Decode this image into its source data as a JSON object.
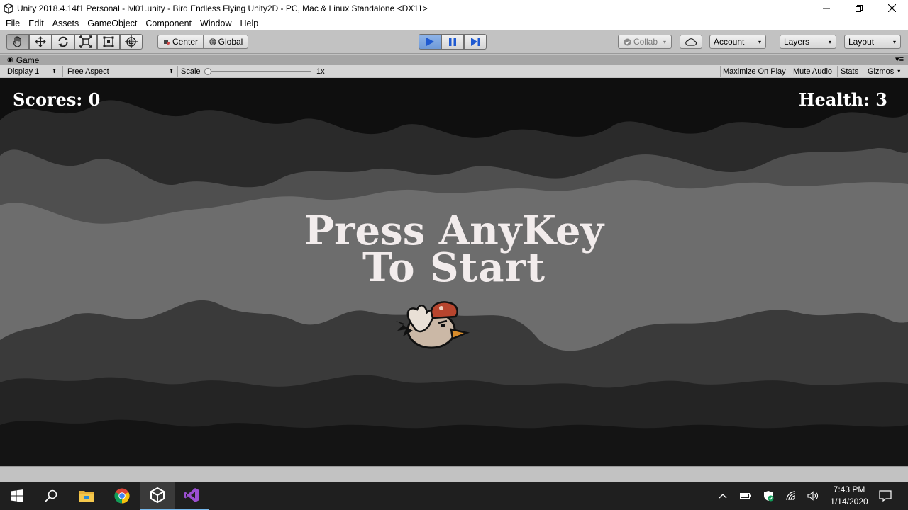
{
  "window": {
    "title": "Unity 2018.4.14f1 Personal - lvl01.unity - Bird Endless Flying Unity2D - PC, Mac & Linux Standalone <DX11>",
    "icons": [
      "unity-logo-icon",
      "minimize-icon",
      "restore-icon",
      "close-icon"
    ]
  },
  "menu": {
    "items": [
      "File",
      "Edit",
      "Assets",
      "GameObject",
      "Component",
      "Window",
      "Help"
    ]
  },
  "toolbar": {
    "tools": [
      "hand-tool-icon",
      "move-tool-icon",
      "rotate-tool-icon",
      "scale-tool-icon",
      "rect-tool-icon",
      "transform-tool-icon"
    ],
    "pivot_label": "Center",
    "space_label": "Global",
    "play_state": "playing",
    "collab_label": "Collab",
    "account_label": "Account",
    "layers_label": "Layers",
    "layout_label": "Layout"
  },
  "game_tab": {
    "label": "Game",
    "display": "Display 1",
    "aspect": "Free Aspect",
    "scale_label": "Scale",
    "scale_value": "1x",
    "maximize_label": "Maximize On Play",
    "mute_label": "Mute Audio",
    "stats_label": "Stats",
    "gizmos_label": "Gizmos"
  },
  "game": {
    "scores": "Scores: 0",
    "health": "Health: 3",
    "prompt_line1": "Press AnyKey",
    "prompt_line2": "To Start",
    "colors": {
      "sky_dark": "#0f0f0f",
      "cloud_back": "#2c2c2c",
      "cloud_mid": "#505050",
      "band": "#6e6e6e",
      "cloud_front": "#3b3b3b",
      "bottom": "#161616"
    }
  },
  "taskbar": {
    "items": [
      "windows-start-icon",
      "search-icon",
      "file-explorer-icon",
      "chrome-icon",
      "unity-icon",
      "visual-studio-icon"
    ],
    "active": "unity-icon",
    "tray": [
      "show-hidden-icons-icon",
      "battery-icon",
      "security-icon",
      "wifi-icon",
      "volume-icon"
    ],
    "time": "7:43 PM",
    "date": "1/14/2020"
  }
}
